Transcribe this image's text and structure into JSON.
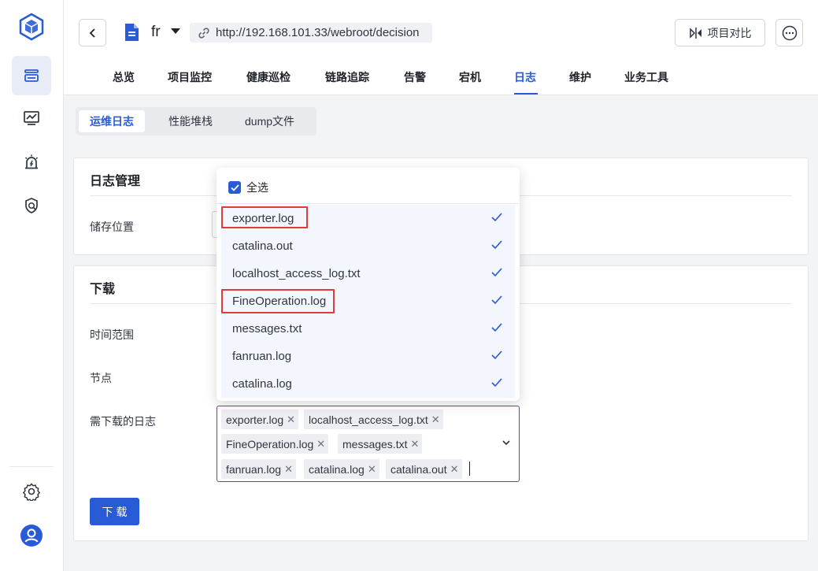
{
  "header": {
    "project_name": "fr",
    "url": "http://192.168.101.33/webroot/decision",
    "compare_label": "项目对比"
  },
  "tabs": [
    {
      "label": "总览"
    },
    {
      "label": "项目监控"
    },
    {
      "label": "健康巡检"
    },
    {
      "label": "链路追踪"
    },
    {
      "label": "告警"
    },
    {
      "label": "宕机"
    },
    {
      "label": "日志"
    },
    {
      "label": "维护"
    },
    {
      "label": "业务工具"
    }
  ],
  "active_tab": "日志",
  "subtabs": [
    {
      "label": "运维日志"
    },
    {
      "label": "性能堆栈"
    },
    {
      "label": "dump文件"
    }
  ],
  "log_mgmt": {
    "title": "日志管理",
    "storage_label": "储存位置"
  },
  "download": {
    "title": "下载",
    "time_range_label": "时间范围",
    "node_label": "节点",
    "logs_label": "需下载的日志",
    "button_label": "下载"
  },
  "selected_logs": [
    {
      "label": "exporter.log"
    },
    {
      "label": "localhost_access_log.txt"
    },
    {
      "label": "FineOperation.log"
    },
    {
      "label": "messages.txt"
    },
    {
      "label": "fanruan.log"
    },
    {
      "label": "catalina.log"
    },
    {
      "label": "catalina.out"
    }
  ],
  "dropdown": {
    "select_all_label": "全选",
    "select_all_checked": true,
    "options": [
      {
        "label": "exporter.log",
        "checked": true,
        "highlighted": true
      },
      {
        "label": "catalina.out",
        "checked": true,
        "highlighted": false
      },
      {
        "label": "localhost_access_log.txt",
        "checked": true,
        "highlighted": false
      },
      {
        "label": "FineOperation.log",
        "checked": true,
        "highlighted": true
      },
      {
        "label": "messages.txt",
        "checked": true,
        "highlighted": false
      },
      {
        "label": "fanruan.log",
        "checked": true,
        "highlighted": false
      },
      {
        "label": "catalina.log",
        "checked": true,
        "highlighted": false
      }
    ]
  },
  "colors": {
    "accent": "#2a5bd7",
    "highlight_border": "#e0393e"
  },
  "icons": [
    "cube-logo-icon",
    "layers-icon",
    "monitor-chart-icon",
    "alarm-icon",
    "shield-check-icon",
    "gear-icon",
    "user-icon",
    "chevron-left-icon",
    "document-icon",
    "link-icon",
    "compare-icon",
    "more-icon",
    "check-icon",
    "chevron-down-icon",
    "close-icon"
  ]
}
